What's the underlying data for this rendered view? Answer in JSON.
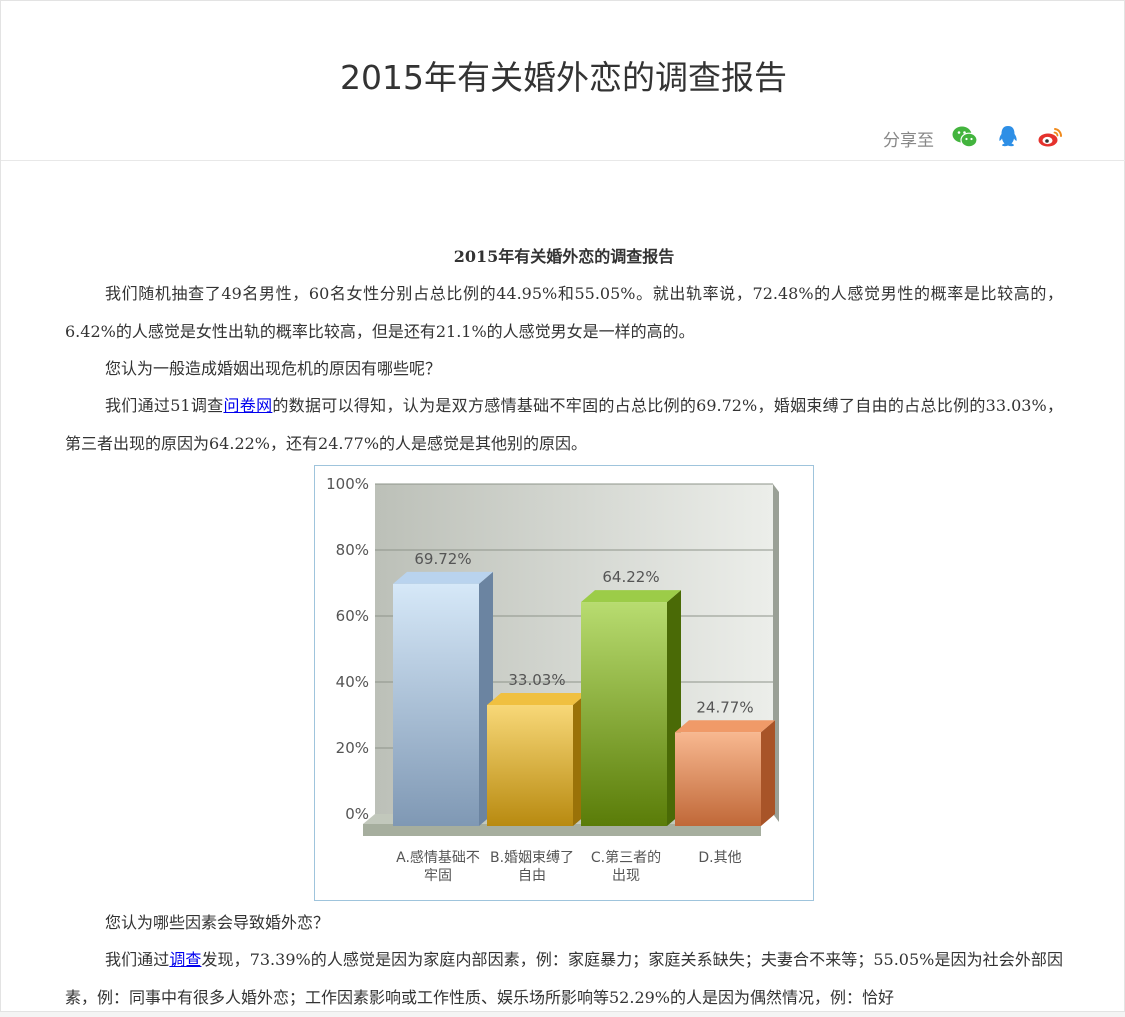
{
  "header": {
    "title": "2015年有关婚外恋的调查报告",
    "share_label": "分享至",
    "share_icons": [
      "wechat-icon",
      "qq-icon",
      "weibo-icon"
    ],
    "colors": {
      "wechat": "#43b43e",
      "qq": "#2e8fe6",
      "weibo": "#e5322d"
    }
  },
  "article": {
    "heading": "2015年有关婚外恋的调查报告",
    "p1": "我们随机抽查了49名男性，60名女性分别占总比例的44.95%和55.05%。就出轨率说，72.48%的人感觉男性的概率是比较高的，6.42%的人感觉是女性出轨的概率比较高，但是还有21.1%的人感觉男女是一样的高的。",
    "q1": "您认为一般造成婚姻出现危机的原因有哪些呢？",
    "p2_before": "我们通过51调查",
    "p2_link": "问卷网",
    "p2_after": "的数据可以得知，认为是双方感情基础不牢固的占总比例的69.72%，婚姻束缚了自由的占总比例的33.03%，第三者出现的原因为64.22%，还有24.77%的人是感觉是其他别的原因。",
    "q2": "您认为哪些因素会导致婚外恋？",
    "p3_before": "我们通过",
    "p3_link": "调查",
    "p3_after": "发现，73.39%的人感觉是因为家庭内部因素，例：家庭暴力；家庭关系缺失；夫妻合不来等；55.05%是因为社会外部因素，例：同事中有很多人婚外恋；工作因素影响或工作性质、娱乐场所影响等52.29%的人是因为偶然情况，例：恰好"
  },
  "chart_data": {
    "type": "bar",
    "categories": [
      "A.感情基础不牢固",
      "B.婚姻束缚了自由",
      "C.第三者的出现",
      "D.其他"
    ],
    "category_lines": [
      [
        "A.感情基础不",
        "牢固"
      ],
      [
        "B.婚姻束缚了",
        "自由"
      ],
      [
        "C.第三者的",
        "出现"
      ],
      [
        "D.其他"
      ]
    ],
    "values": [
      69.72,
      33.03,
      64.22,
      24.77
    ],
    "value_labels": [
      "69.72%",
      "33.03%",
      "64.22%",
      "24.77%"
    ],
    "yticks": [
      "0%",
      "20%",
      "40%",
      "60%",
      "80%",
      "100%"
    ],
    "ylim": [
      0,
      100
    ],
    "grid": true,
    "style": "3d",
    "colors": [
      {
        "front_top": "#d6e8f8",
        "front_bottom": "#7f98b4",
        "side": "#6b84a1",
        "top": "#b9d3ee"
      },
      {
        "front_top": "#f8d878",
        "front_bottom": "#b88a10",
        "side": "#9a7208",
        "top": "#f0c040"
      },
      {
        "front_top": "#b8dc70",
        "front_bottom": "#5a7c08",
        "side": "#4a6a06",
        "top": "#9ccc48"
      },
      {
        "front_top": "#f8b890",
        "front_bottom": "#c06838",
        "side": "#a85428",
        "top": "#f09a68"
      }
    ]
  }
}
